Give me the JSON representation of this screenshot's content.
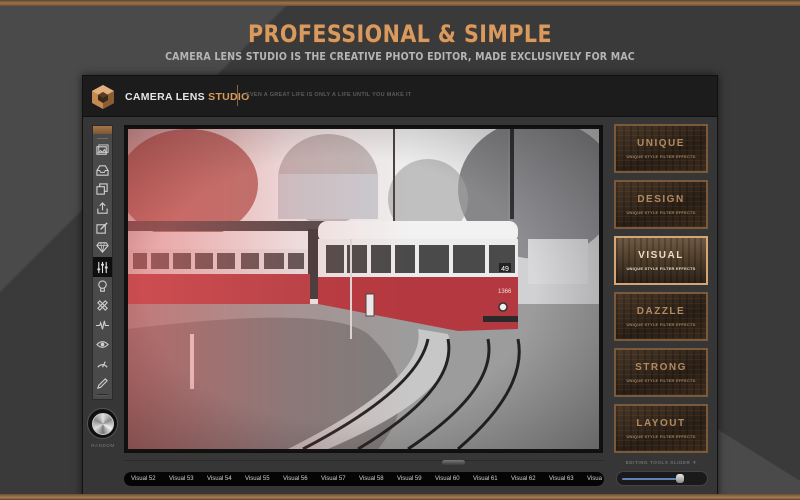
{
  "marketing": {
    "headline": "PROFESSIONAL & SIMPLE",
    "subline": "CAMERA LENS STUDIO IS THE CREATIVE PHOTO EDITOR, MADE EXCLUSIVELY FOR MAC"
  },
  "app": {
    "name_main": "CAMERA LENS ",
    "name_accent": "STUDIO",
    "tagline": "EVEN A GREAT LIFE IS ONLY A LIFE UNTIL YOU MAKE IT",
    "accent_color": "#d99a5f"
  },
  "toolbar": {
    "tools": [
      {
        "icon": "photos-icon"
      },
      {
        "icon": "inbox-icon"
      },
      {
        "icon": "layers-icon"
      },
      {
        "icon": "share-icon"
      },
      {
        "icon": "edit-icon"
      },
      {
        "icon": "diamond-icon"
      },
      {
        "icon": "sliders-icon",
        "active": true
      },
      {
        "icon": "lightbulb-icon"
      },
      {
        "icon": "bandage-icon"
      },
      {
        "icon": "pulse-icon"
      },
      {
        "icon": "eye-icon"
      },
      {
        "icon": "speedometer-icon"
      },
      {
        "icon": "pencil-icon"
      }
    ],
    "random_label": "RANDOM"
  },
  "canvas": {
    "photo_description": "Red tram on curved tracks, selective color edit",
    "tram_number": "1366",
    "route_number": "49"
  },
  "filter_strip": {
    "items": [
      "Visual 52",
      "Visual 53",
      "Visual 54",
      "Visual 55",
      "Visual 56",
      "Visual 57",
      "Visual 58",
      "Visual 59",
      "Visual 60",
      "Visual 61",
      "Visual 62",
      "Visual 63",
      "Visua"
    ]
  },
  "presets": {
    "subtitle": "UNIQUE STYLE FILTER EFFECTS",
    "items": [
      {
        "title": "UNIQUE"
      },
      {
        "title": "DESIGN"
      },
      {
        "title": "VISUAL",
        "active": true
      },
      {
        "title": "DAZZLE"
      },
      {
        "title": "STRONG"
      },
      {
        "title": "LAYOUT"
      }
    ]
  },
  "slider": {
    "label": "EDITING TOOLS SLIDER ▼",
    "value_fraction": 0.72
  }
}
